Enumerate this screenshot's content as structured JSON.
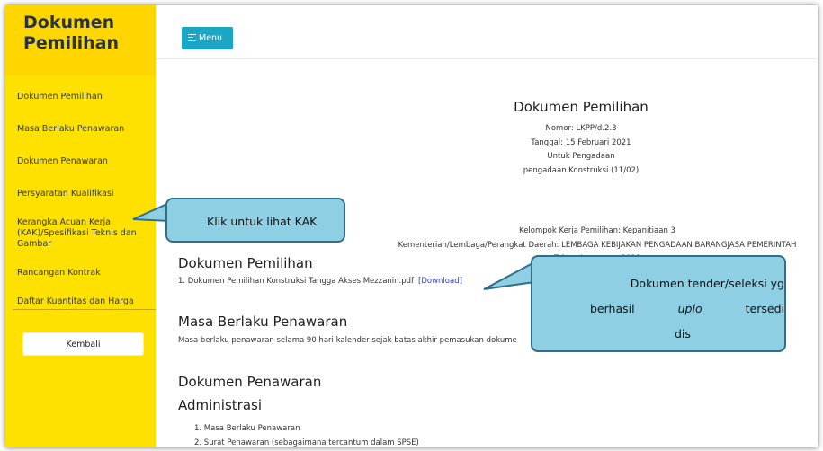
{
  "sidebar": {
    "title": "Dokumen Pemilihan",
    "items": [
      "Dokumen Pemilihan",
      "Masa Berlaku Penawaran",
      "Dokumen Penawaran",
      "Persyaratan Kualifikasi",
      "Kerangka Acuan Kerja (KAK)/Spesifikasi Teknis dan Gambar",
      "Rancangan Kontrak",
      "Daftar Kuantitas dan Harga"
    ],
    "back_label": "Kembali"
  },
  "toolbar": {
    "menu_label": "Menu"
  },
  "document": {
    "title": "Dokumen Pemilihan",
    "nomor": "Nomor: LKPP/d.2.3",
    "tanggal": "Tanggal: 15 Februari 2021",
    "untuk": "Untuk Pengadaan",
    "pengadaan": "pengadaan Konstruksi (11/02)",
    "kelompok": "Kelompok Kerja Pemilihan: Kepanitiaan 3",
    "kementerian": "Kementerian/Lembaga/Perangkat Daerah: LEMBAGA KEBIJAKAN PENGADAAN BARANGJASA PEMERINTAH",
    "tahun": "Tahun Anggaran: 2021"
  },
  "sections": {
    "dokumen_pemilihan": {
      "title": "Dokumen Pemilihan",
      "file": "1. Dokumen Pemilihan Konstruksi Tangga Akses Mezzanin.pdf",
      "download_label": "[Download]"
    },
    "masa_berlaku": {
      "title": "Masa Berlaku Penawaran",
      "text": "Masa berlaku penawaran selama 90 hari kalender sejak batas akhir pemasukan dokume"
    },
    "dokumen_penawaran": {
      "title": "Dokumen Penawaran",
      "subtitle": "Administrasi",
      "items": [
        "1. Masa Berlaku Penawaran",
        "2. Surat Penawaran (sebagaimana tercantum dalam SPSE)"
      ]
    }
  },
  "callouts": {
    "kak": "Klik untuk lihat KAK",
    "tender_line1": "Dokumen tender/seleksi yg",
    "tender_line2a": "berhasil",
    "tender_line2b": "uplo",
    "tender_line2c": "tersedi",
    "tender_line3": "dis"
  },
  "colors": {
    "sidebar": "#ffe100",
    "sidebar_head": "#ffd600",
    "menu_button": "#1aa6c4",
    "callout": "#8ecfe3",
    "link": "#2a3fc6"
  }
}
